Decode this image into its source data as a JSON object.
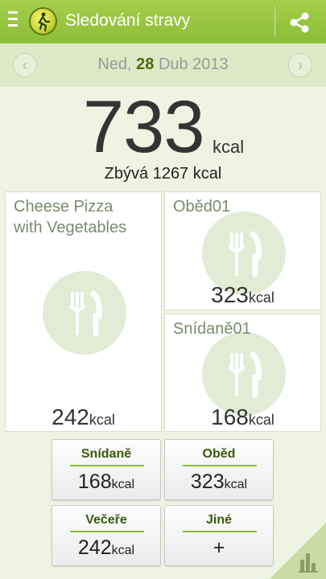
{
  "header": {
    "title": "Sledování stravy"
  },
  "date_bar": {
    "weekday": "Ned,",
    "day": "28",
    "month_year": "Dub 2013"
  },
  "summary": {
    "consumed": "733",
    "unit": "kcal",
    "remaining": "Zbývá 1267 kcal"
  },
  "tiles": [
    {
      "title": "Cheese Pizza\nwith Vegetables",
      "value": "242",
      "unit": "kcal"
    },
    {
      "title": "Oběd01",
      "value": "323",
      "unit": "kcal"
    },
    {
      "title": "Snídaně01",
      "value": "168",
      "unit": "kcal"
    }
  ],
  "categories": [
    {
      "label": "Snídaně",
      "value": "168",
      "unit": "kcal"
    },
    {
      "label": "Oběd",
      "value": "323",
      "unit": "kcal"
    },
    {
      "label": "Večeře",
      "value": "242",
      "unit": "kcal"
    },
    {
      "label": "Jiné",
      "value": "+"
    }
  ],
  "icons": [
    "menu-icon",
    "app-logo-icon",
    "share-icon",
    "chevron-left-icon",
    "chevron-right-icon",
    "fork-knife-icon",
    "bar-chart-icon"
  ],
  "colors": {
    "accent": "#8cbd36",
    "background": "#eef4e1",
    "dark_green": "#3b5a0f"
  }
}
